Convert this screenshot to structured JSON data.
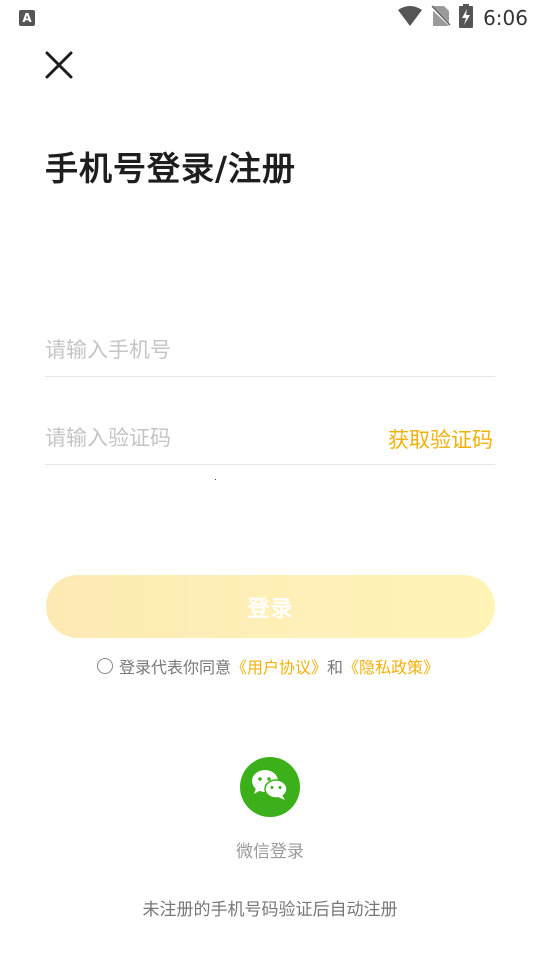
{
  "status_bar": {
    "app_icon_letter": "A",
    "time": "6:06",
    "icons": [
      "wifi-icon",
      "no-sim-icon",
      "battery-charging-icon"
    ]
  },
  "header": {
    "close_icon": "close-icon",
    "title": "手机号登录/注册"
  },
  "form": {
    "phone_placeholder": "请输入手机号",
    "phone_value": "",
    "code_placeholder": "请输入验证码",
    "code_value": "",
    "get_code_label": "获取验证码",
    "login_label": "登录",
    "login_gradient": [
      "#fde9b3",
      "#fff3b6"
    ]
  },
  "agreement": {
    "prefix": "登录代表你同意",
    "user_agreement": "《用户协议》",
    "conjunction": "和",
    "privacy_policy": "《隐私政策》",
    "link_color": "#f1b10b"
  },
  "third_party": {
    "wechat_icon": "wechat-icon",
    "wechat_color": "#3bb01a",
    "wechat_label": "微信登录"
  },
  "footer": {
    "note": "未注册的手机号码验证后自动注册"
  }
}
